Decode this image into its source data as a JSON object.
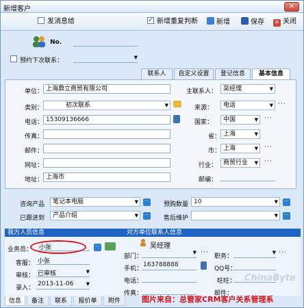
{
  "window": {
    "title": "新增客户",
    "close_label": "✕"
  },
  "toolbar": {
    "message_checkbox": "发消息给",
    "repeat_checkbox": "新增重复判断",
    "new_label": "新增",
    "save_label": "保存",
    "close_label": "关闭"
  },
  "header": {
    "no_label": "No.",
    "reminder_label": "预约下次联系：",
    "reminder_value": ""
  },
  "tabs": [
    "联系人",
    "自定义设置",
    "登记信息",
    "基本信息"
  ],
  "form": {
    "unit_label": "单位：",
    "unit_value": "上海鼎立商贸有限公司",
    "main_contact_label": "主联系人：",
    "main_contact_value": "吴经理",
    "category_label": "类别：",
    "category_value": "初次联系",
    "source_label": "来源：",
    "source_value": "电话",
    "phone_label": "电话：",
    "phone_value": "15309136666",
    "country_label": "国家：",
    "country_value": "中国",
    "fax_label": "传真：",
    "province_label": "省：",
    "province_value": "上海",
    "email_label": "邮件：",
    "city_label": "市：",
    "city_value": "上海",
    "website_label": "网址：",
    "industry_label": "行业：",
    "industry_value": "商贸行业",
    "address_label": "地址：",
    "address_value": "上海市",
    "zip_label": "邮编："
  },
  "product": {
    "consult_label": "咨询产品",
    "consult_value": "笔记本电脑",
    "qty_label": "预购数量",
    "qty_value": "10",
    "followed_label": "已跟进到",
    "followed_value": "产品介绍",
    "after_label": "售后维护",
    "after_value": ""
  },
  "section": {
    "ours": "我方人员信息",
    "theirs": "对方单位联系人信息"
  },
  "ours": {
    "salesman_label": "业务员：",
    "salesman_value": "小张",
    "service_label": "客服：",
    "service_value": "小张",
    "audit_label": "审核：",
    "audit_value": "已审核",
    "entry_label": "录入：",
    "entry_value": "2013-11-06"
  },
  "theirs": {
    "name": "吴经理",
    "dept_label": "部门：",
    "post_label": "职务：",
    "mobile_label": "手机：",
    "mobile_value": "163788888",
    "qq_label": "QQ号：",
    "tel_label": "电话：",
    "wangwang_label": "旺旺：",
    "fax_label": "传真：",
    "email_label": "邮件："
  },
  "bottom_tabs": [
    "信息",
    "备注",
    "联系",
    "报价单",
    "附件"
  ],
  "caption": "图片来自：总管家CRM客户关系管理系",
  "watermark": "ChinaByte",
  "colors": {
    "accent": "#1f63c4",
    "highlight": "#e0131b"
  }
}
